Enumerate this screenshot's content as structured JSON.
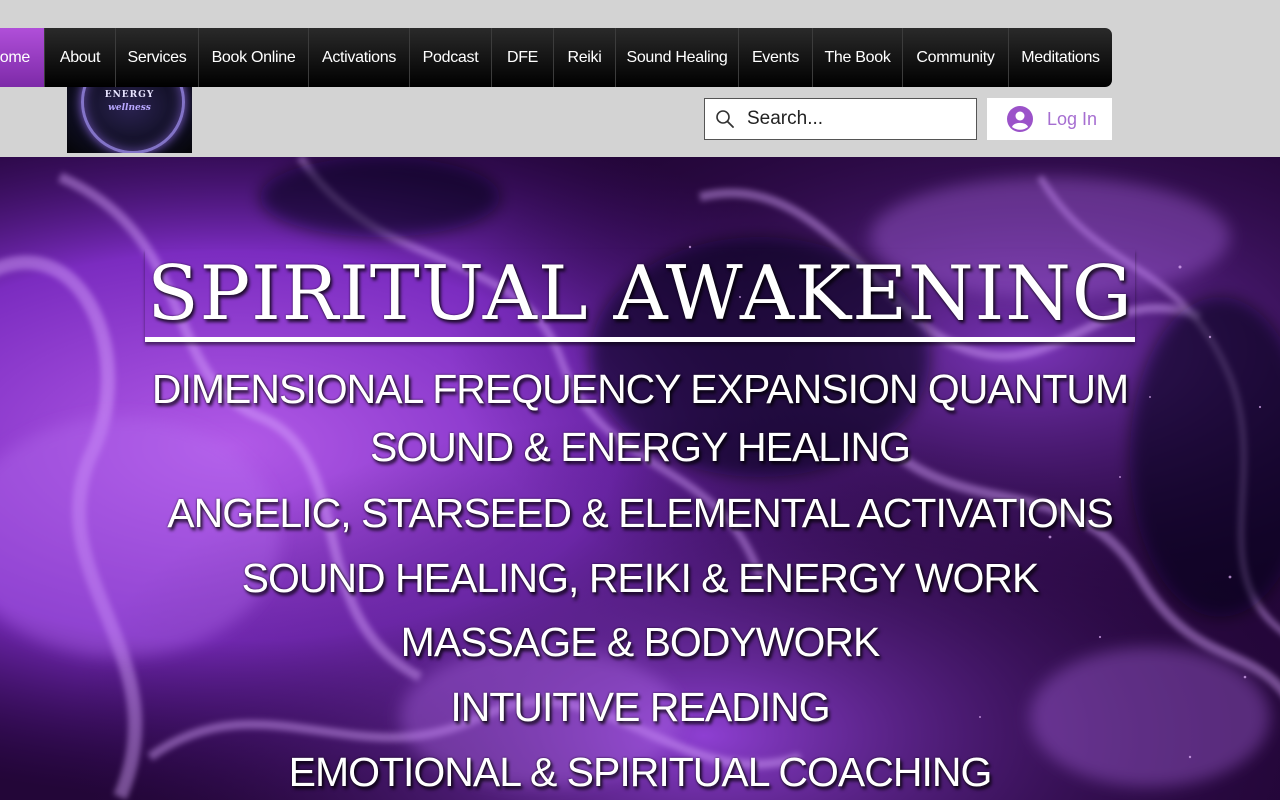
{
  "nav": {
    "items": [
      {
        "label": "ome",
        "active": true
      },
      {
        "label": "About"
      },
      {
        "label": "Services"
      },
      {
        "label": "Book Online"
      },
      {
        "label": "Activations"
      },
      {
        "label": "Podcast"
      },
      {
        "label": "DFE"
      },
      {
        "label": "Reiki"
      },
      {
        "label": "Sound Healing"
      },
      {
        "label": "Events"
      },
      {
        "label": "The Book"
      },
      {
        "label": "Community"
      },
      {
        "label": "Meditations"
      }
    ]
  },
  "logo": {
    "line1": "ENERGY",
    "line2": "wellness"
  },
  "search": {
    "placeholder": "Search..."
  },
  "login": {
    "label": "Log In"
  },
  "hero": {
    "title": "SPIRITUAL AWAKENING",
    "lines": [
      "DIMENSIONAL FREQUENCY EXPANSION QUANTUM",
      "SOUND & ENERGY HEALING",
      "ANGELIC, STARSEED & ELEMENTAL ACTIVATIONS",
      "SOUND HEALING, REIKI & ENERGY WORK",
      "MASSAGE & BODYWORK",
      "INTUITIVE READING",
      "EMOTIONAL & SPIRITUAL COACHING"
    ]
  },
  "colors": {
    "nav_active": "#9b3fcc",
    "login_text": "#a66ed1",
    "hero_bg": "#1c0530"
  }
}
